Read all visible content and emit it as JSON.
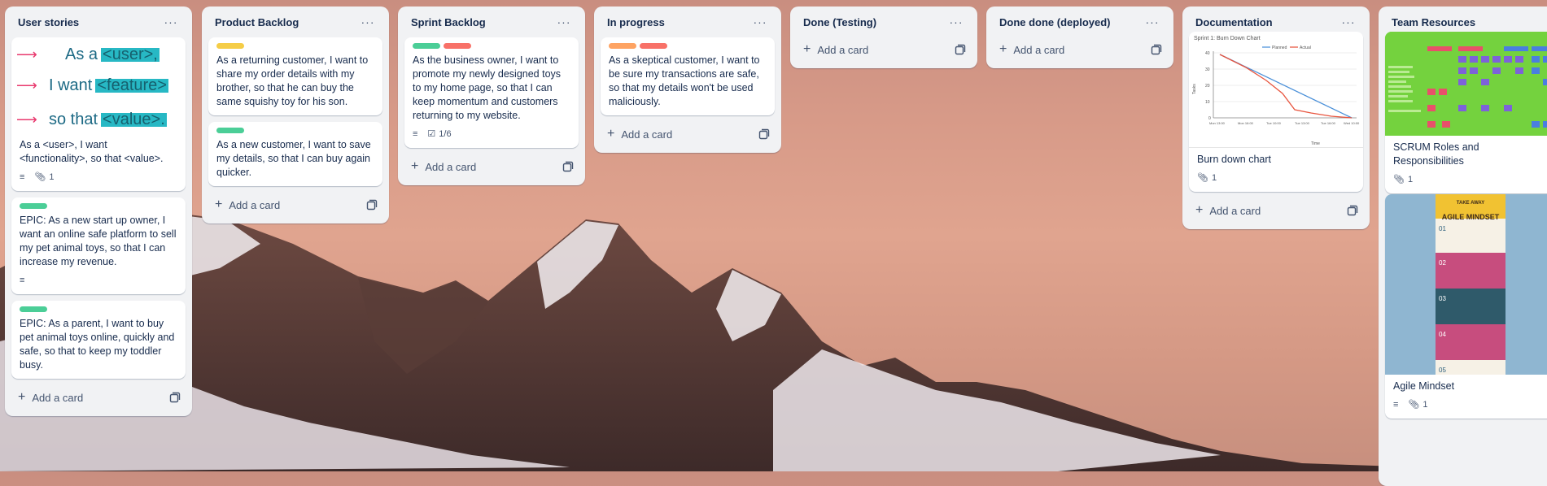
{
  "lists": [
    {
      "title": "User stories",
      "cover_lines": [
        {
          "prefix": "As a",
          "highlight": "<user>,"
        },
        {
          "prefix": "I want",
          "highlight": "<feature>"
        },
        {
          "prefix": "so that",
          "highlight": "<value>."
        }
      ],
      "cards": [
        {
          "text": "As a <user>, I want <functionality>, so that <value>.",
          "attachments": "1"
        },
        {
          "text": "EPIC: As a new start up owner, I want an online safe platform to sell my pet animal toys, so that I can increase my revenue."
        },
        {
          "text": "EPIC: As a parent, I want to buy pet animal toys online, quickly and safe, so that to keep my toddler busy."
        }
      ],
      "add_label": "Add a card"
    },
    {
      "title": "Product Backlog",
      "cards": [
        {
          "text": "As a returning customer, I want to share my order details with my brother, so that he can buy the same squishy toy for his son."
        },
        {
          "text": "As a new customer, I want to save my details, so that I can buy again quicker."
        }
      ],
      "add_label": "Add a card"
    },
    {
      "title": "Sprint Backlog",
      "cards": [
        {
          "text": "As the business owner, I want to promote my newly designed toys to my home page, so that I can keep momentum and customers returning to my website.",
          "checklist": "1/6"
        }
      ],
      "add_label": "Add a card"
    },
    {
      "title": "In progress",
      "cards": [
        {
          "text": "As a skeptical customer, I want to be sure my transactions are safe, so that my details won't be used maliciously."
        }
      ],
      "add_label": "Add a card"
    },
    {
      "title": "Done (Testing)",
      "add_label": "Add a card"
    },
    {
      "title": "Done done (deployed)",
      "add_label": "Add a card"
    },
    {
      "title": "Documentation",
      "burndown": {
        "title": "Sprint 1: Burn Down Chart",
        "legend_planned": "Planned",
        "legend_actual": "Actual",
        "ylabel": "Tasks",
        "xlabel": "Time",
        "yticks": [
          "40",
          "30",
          "20",
          "10",
          "0"
        ],
        "xticks": [
          "Mon 13:00",
          "Mon 16:00",
          "Tue 10:00",
          "Tue 13:00",
          "Tue 16:00",
          "Wed 10:00"
        ]
      },
      "cards": [
        {
          "text": "Burn down chart",
          "attachments": "1"
        }
      ],
      "add_label": "Add a card"
    },
    {
      "title": "Team Resources",
      "cards": [
        {
          "text": "SCRUM Roles and Responsibilities",
          "attachments": "1"
        },
        {
          "text": "Agile Mindset",
          "attachments": "1"
        }
      ],
      "agile_cover": {
        "banner_top": "TAKE AWAY",
        "banner_main": "AGILE MINDSET",
        "steps": [
          "01",
          "02",
          "03",
          "04",
          "05"
        ]
      }
    }
  ],
  "colors": {
    "label_green": "#4bce97",
    "label_red": "#f87168",
    "label_yellow": "#f5cd47",
    "label_orange": "#fea362",
    "highlight_teal": "#27b8c4",
    "arrow_pink": "#e8386d"
  }
}
